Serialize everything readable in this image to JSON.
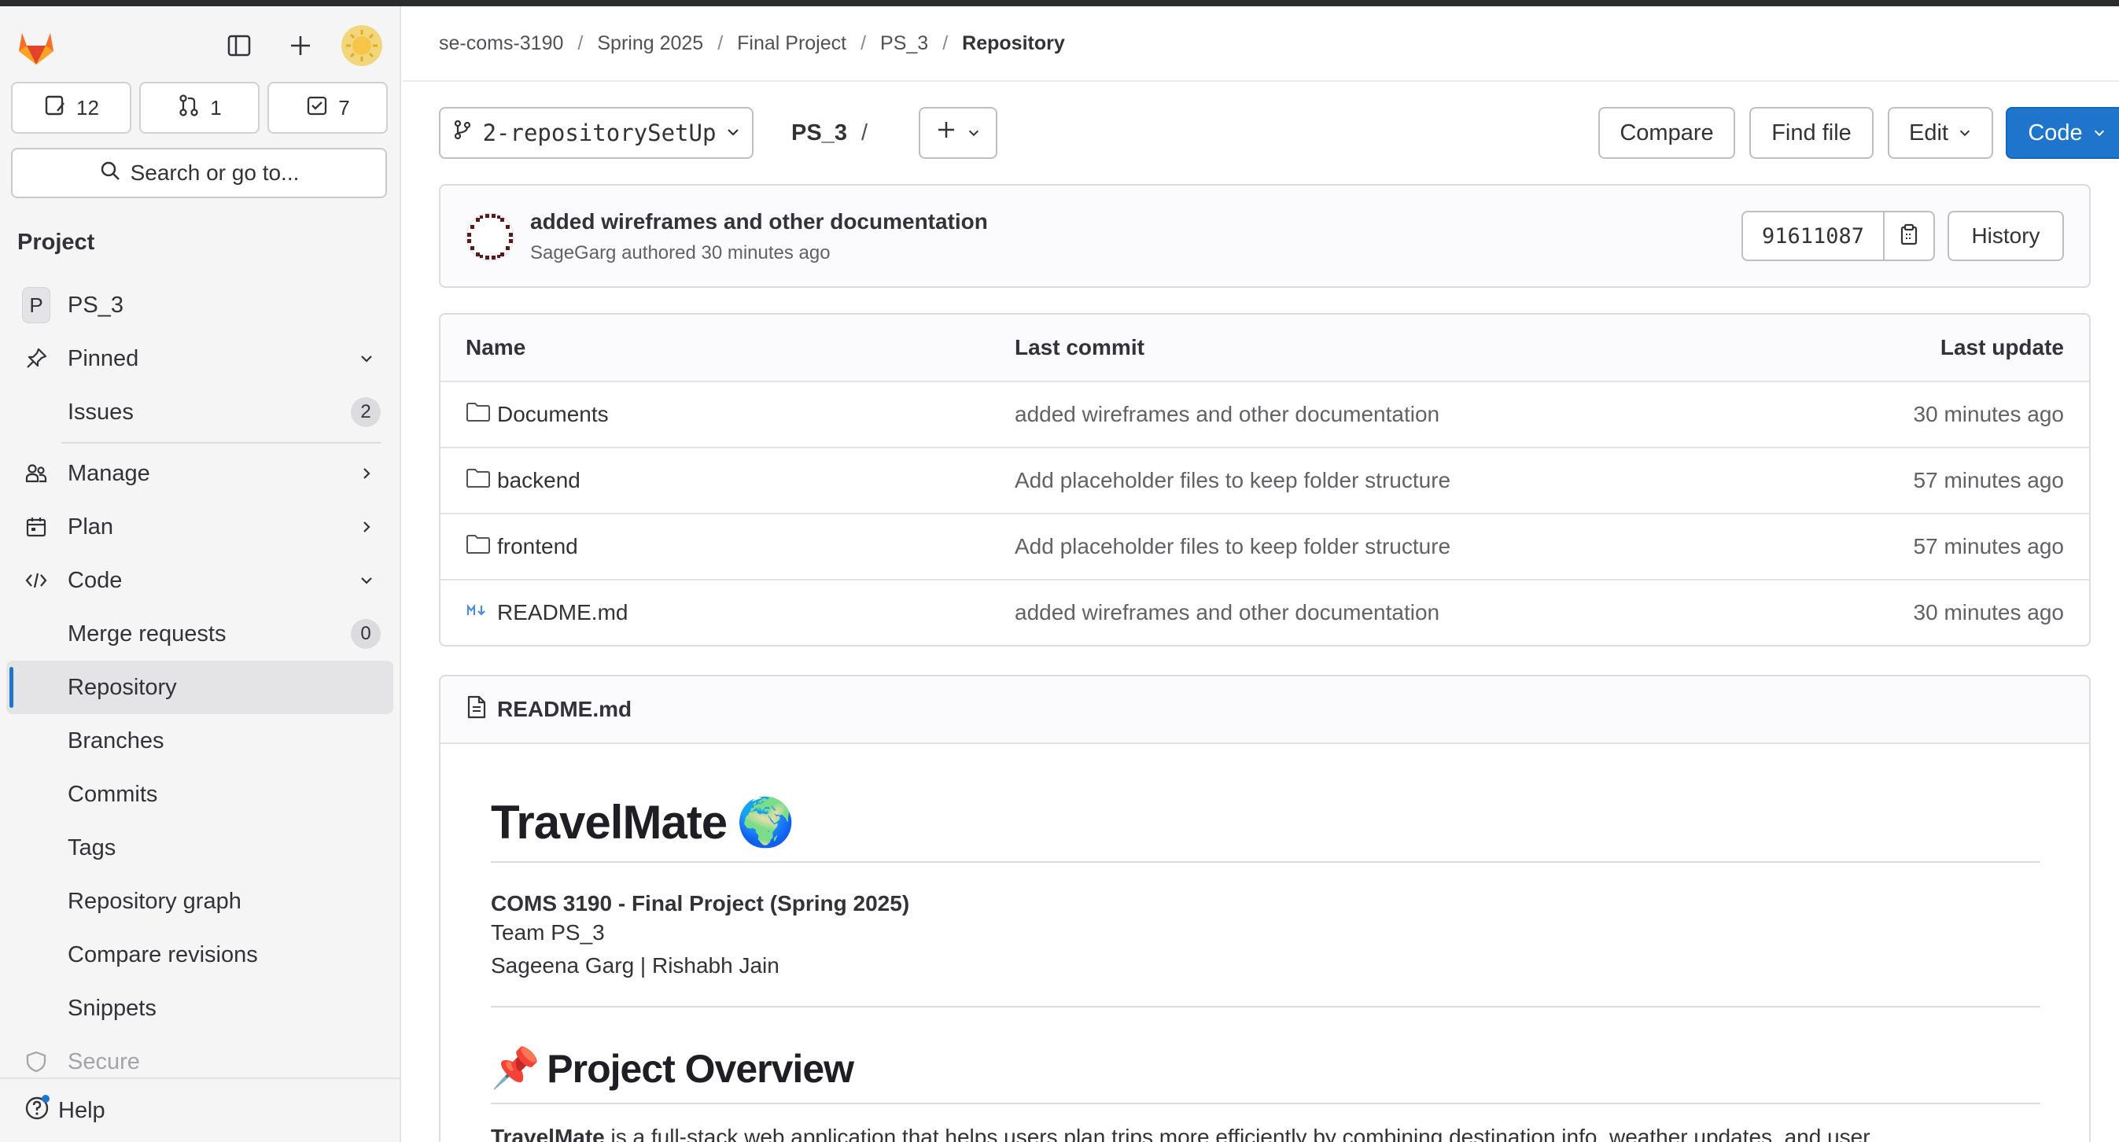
{
  "sidebar": {
    "counters": [
      {
        "icon": "issues-icon",
        "count": "12"
      },
      {
        "icon": "merge-request-icon",
        "count": "1"
      },
      {
        "icon": "todo-icon",
        "count": "7"
      }
    ],
    "search_label": "Search or go to...",
    "section_title": "Project",
    "project_initial": "P",
    "project_name": "PS_3",
    "pinned_label": "Pinned",
    "issues_label": "Issues",
    "issues_badge": "2",
    "manage_label": "Manage",
    "plan_label": "Plan",
    "code_label": "Code",
    "code_items": [
      {
        "label": "Merge requests",
        "badge": "0"
      },
      {
        "label": "Repository"
      },
      {
        "label": "Branches"
      },
      {
        "label": "Commits"
      },
      {
        "label": "Tags"
      },
      {
        "label": "Repository graph"
      },
      {
        "label": "Compare revisions"
      },
      {
        "label": "Snippets"
      }
    ],
    "secure_label": "Secure",
    "help_label": "Help"
  },
  "breadcrumb": [
    "se-coms-3190",
    "Spring 2025",
    "Final Project",
    "PS_3",
    "Repository"
  ],
  "toolbar": {
    "branch": "2-repositorySetUp",
    "project_path": "PS_3",
    "path_sep": "/",
    "compare_label": "Compare",
    "find_file_label": "Find file",
    "edit_label": "Edit",
    "code_label": "Code"
  },
  "last_commit": {
    "title": "added wireframes and other documentation",
    "author_line": "SageGarg authored 30 minutes ago",
    "sha": "91611087",
    "history_label": "History"
  },
  "file_table": {
    "headers": {
      "name": "Name",
      "last_commit": "Last commit",
      "last_update": "Last update"
    },
    "rows": [
      {
        "name": "Documents",
        "type": "folder",
        "commit": "added wireframes and other documentation",
        "updated": "30 minutes ago"
      },
      {
        "name": "backend",
        "type": "folder",
        "commit": "Add placeholder files to keep folder structure",
        "updated": "57 minutes ago"
      },
      {
        "name": "frontend",
        "type": "folder",
        "commit": "Add placeholder files to keep folder structure",
        "updated": "57 minutes ago"
      },
      {
        "name": "README.md",
        "type": "markdown",
        "commit": "added wireframes and other documentation",
        "updated": "30 minutes ago"
      }
    ]
  },
  "readme": {
    "filename": "README.md",
    "title": "TravelMate",
    "title_emoji": "🌍",
    "course_line": "COMS 3190 - Final Project (Spring 2025)",
    "team_line": "Team PS_3",
    "members_line": "Sageena Garg | Rishabh Jain",
    "overview_emoji": "📌",
    "overview_title": "Project Overview",
    "overview_lead": "TravelMate",
    "overview_text": " is a full-stack web application that helps users plan trips more efficiently by combining destination info, weather updates, and user"
  }
}
